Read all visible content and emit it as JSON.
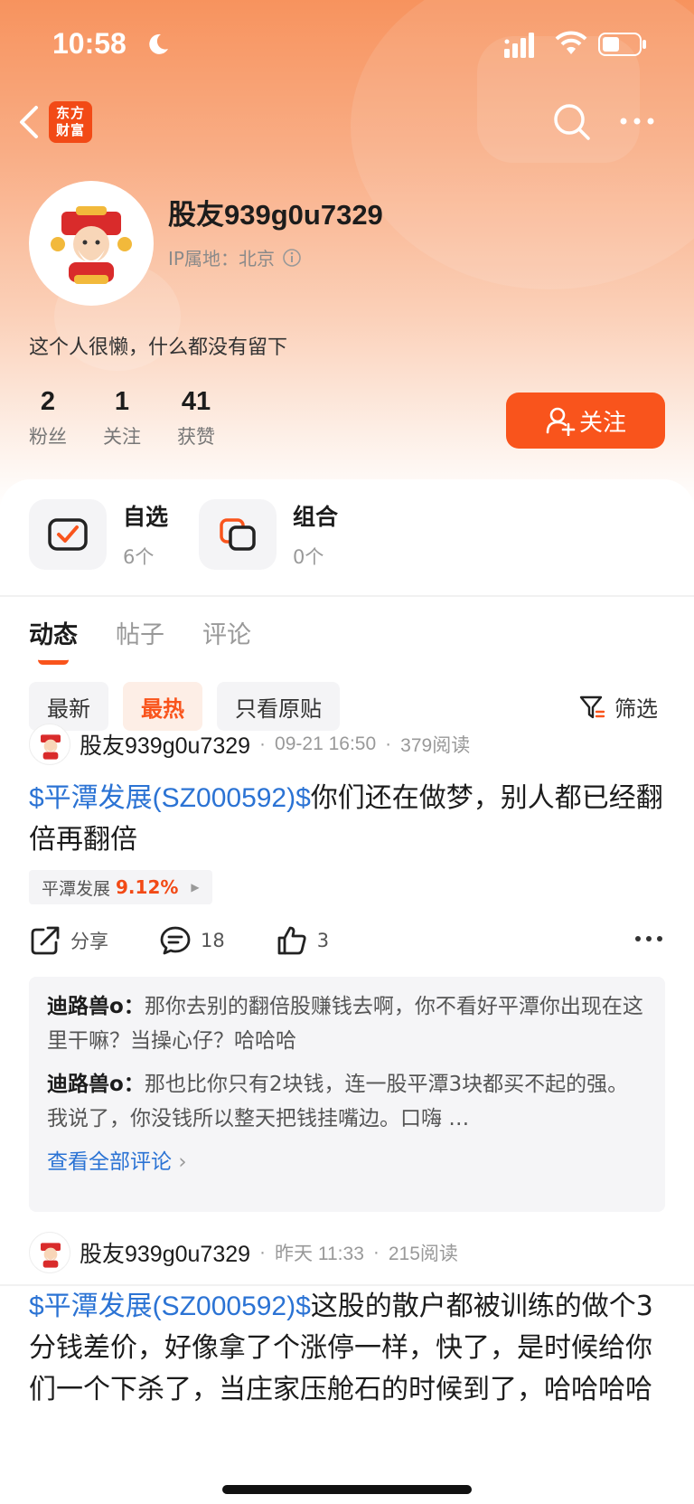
{
  "status_bar": {
    "time": "10:58"
  },
  "nav": {
    "app_logo_line1": "东方",
    "app_logo_line2": "财富"
  },
  "profile": {
    "username": "股友939g0u7329",
    "ip_label": "IP属地：北京",
    "bio": "这个人很懒，什么都没有留下",
    "stats": [
      {
        "num": "2",
        "label": "粉丝"
      },
      {
        "num": "1",
        "label": "关注"
      },
      {
        "num": "41",
        "label": "获赞"
      }
    ],
    "follow_label": "关注"
  },
  "quick_links": [
    {
      "title": "自选",
      "sub": "6个"
    },
    {
      "title": "组合",
      "sub": "0个"
    }
  ],
  "tabs": [
    "动态",
    "帖子",
    "评论"
  ],
  "chips": [
    "最新",
    "最热",
    "只看原贴"
  ],
  "filter_label": "筛选",
  "posts": [
    {
      "author": "股友939g0u7329",
      "time": "09-21 16:50",
      "reads": "379阅读",
      "tag": "$平潭发展(SZ000592)$",
      "text": "你们还在做梦，别人都已经翻倍再翻倍",
      "stock_name": "平潭发展",
      "stock_change": "9.12%",
      "share_label": "分享",
      "comment_count": "18",
      "like_count": "3",
      "comments": [
        {
          "user": "迪路兽o：",
          "text": "那你去别的翻倍股赚钱去啊，你不看好平潭你出现在这里干嘛？当操心仔？哈哈哈"
        },
        {
          "user": "迪路兽o：",
          "text": "那也比你只有2块钱，连一股平潭3块都买不起的强。我说了，你没钱所以整天把钱挂嘴边。口嗨 …"
        }
      ],
      "see_all": "查看全部评论"
    },
    {
      "author": "股友939g0u7329",
      "time": "昨天 11:33",
      "reads": "215阅读",
      "tag": "$平潭发展(SZ000592)$",
      "text": "这股的散户都被训练的做个3分钱差价，好像拿了个涨停一样，快了，是时候给你们一个下杀了，当庄家压舱石的时候到了，哈哈哈哈"
    }
  ]
}
